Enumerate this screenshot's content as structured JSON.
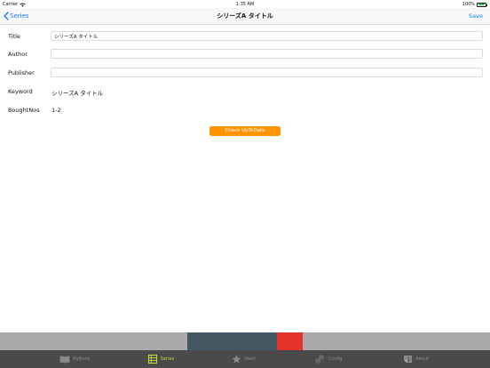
{
  "status_bar": {
    "carrier": "Carrier",
    "time": "1:35 AM",
    "battery": "100%"
  },
  "nav": {
    "back_label": "Series",
    "title": "シリーズA タイトル",
    "save_label": "Save"
  },
  "form": {
    "title_label": "Title",
    "title_value": "シリーズA タイトル",
    "author_label": "Author",
    "author_value": "",
    "publisher_label": "Publisher",
    "publisher_value": "",
    "keyword_label": "Keyword",
    "keyword_value": "シリーズA タイトル",
    "boughtnos_label": "BoughtNos",
    "boughtnos_value": "1-2",
    "check_button_label": "Check UpToDate"
  },
  "tabs": [
    {
      "label": "MyBook",
      "icon": "book-icon",
      "active": false
    },
    {
      "label": "Series",
      "icon": "list-icon",
      "active": true
    },
    {
      "label": "Want",
      "icon": "star-icon",
      "active": false
    },
    {
      "label": "Config",
      "icon": "gear-icon",
      "active": false
    },
    {
      "label": "About",
      "icon": "info-icon",
      "active": false
    }
  ],
  "colors": {
    "accent_blue": "#1a7cf5",
    "button_orange": "#ff9500",
    "tab_active": "#cddc39",
    "tab_bar_bg": "#4a4a4a"
  }
}
